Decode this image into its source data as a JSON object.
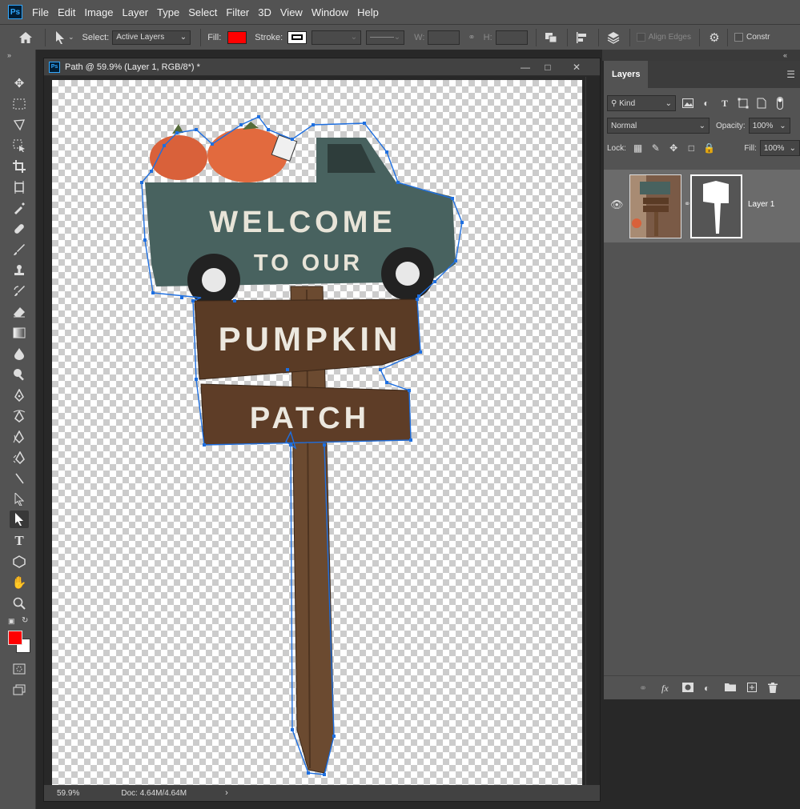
{
  "app": {
    "logo": "Ps"
  },
  "menu": [
    "File",
    "Edit",
    "Image",
    "Layer",
    "Type",
    "Select",
    "Filter",
    "3D",
    "View",
    "Window",
    "Help"
  ],
  "options": {
    "select_label": "Select:",
    "select_value": "Active Layers",
    "fill_label": "Fill:",
    "fill_color": "#ff0000",
    "stroke_label": "Stroke:",
    "w_label": "W:",
    "h_label": "H:",
    "align_edges": "Align Edges",
    "constrain": "Constr"
  },
  "tools": {
    "active": "path-selection",
    "foreground_color": "#ff0000",
    "background_color": "#ffffff"
  },
  "document": {
    "title": "Path @ 59.9% (Layer 1, RGB/8*) *",
    "zoom": "59.9%",
    "doc_size": "Doc: 4.64M/4.64M"
  },
  "artwork": {
    "line1": "WELCOME",
    "line2": "TO OUR",
    "line3": "PUMPKIN",
    "line4": "PATCH",
    "path_color": "#1e6fe0"
  },
  "layers": {
    "tab": "Layers",
    "filter_kind": "Kind",
    "blend_mode": "Normal",
    "opacity_label": "Opacity:",
    "opacity_value": "100%",
    "lock_label": "Lock:",
    "fill_label": "Fill:",
    "fill_value": "100%",
    "items": [
      {
        "name": "Layer 1",
        "visible": true,
        "has_mask": true
      }
    ]
  }
}
